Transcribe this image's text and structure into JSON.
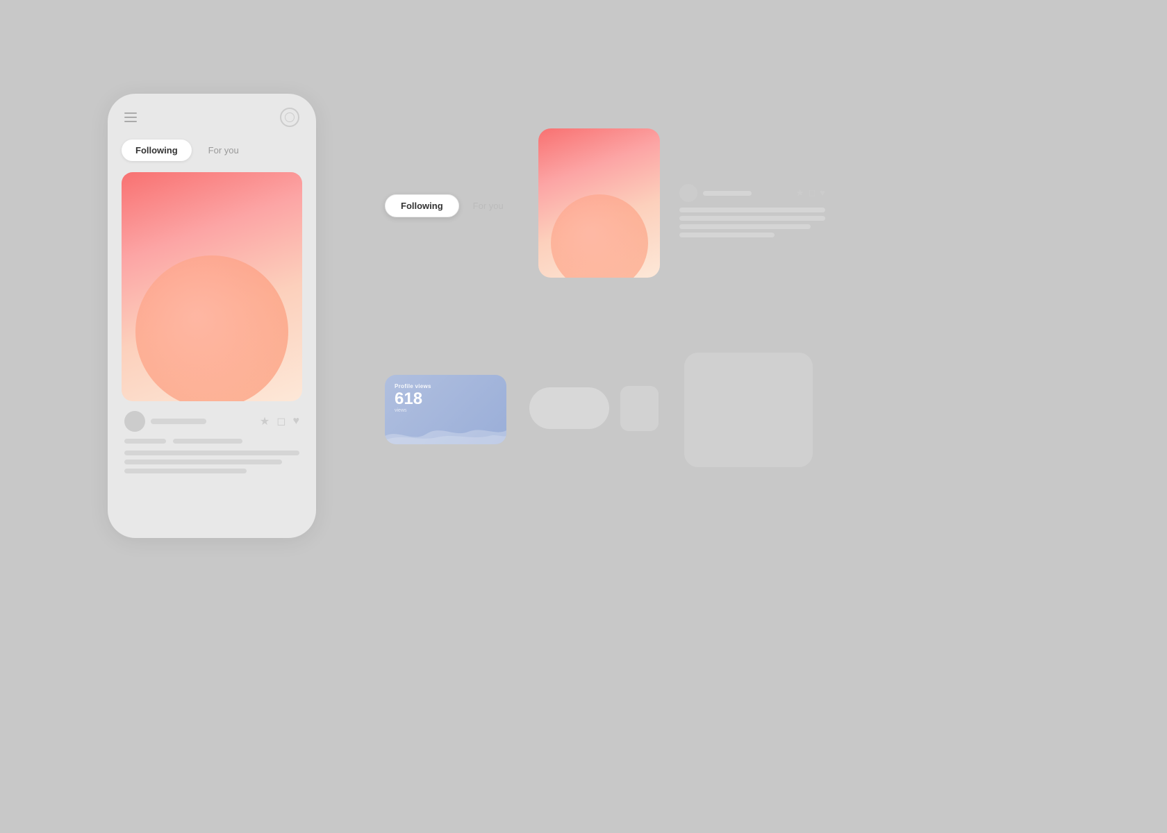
{
  "phone": {
    "tab_following": "Following",
    "tab_for_you": "For you",
    "username_placeholder": "",
    "action_star": "★",
    "action_comment": "💬",
    "action_heart": "♥"
  },
  "floating_tab": {
    "following_label": "Following",
    "for_you_label": "For you"
  },
  "stat_card": {
    "label": "Profile views",
    "value": "618",
    "sub_label": "views"
  },
  "colors": {
    "background": "#c8c8c8",
    "phone_bg": "#e8e8e8",
    "tab_active_bg": "#ffffff",
    "gradient_top": "#f87171",
    "gradient_bottom": "#fde8d8",
    "stat_card_bg": "#a8b4d8"
  }
}
